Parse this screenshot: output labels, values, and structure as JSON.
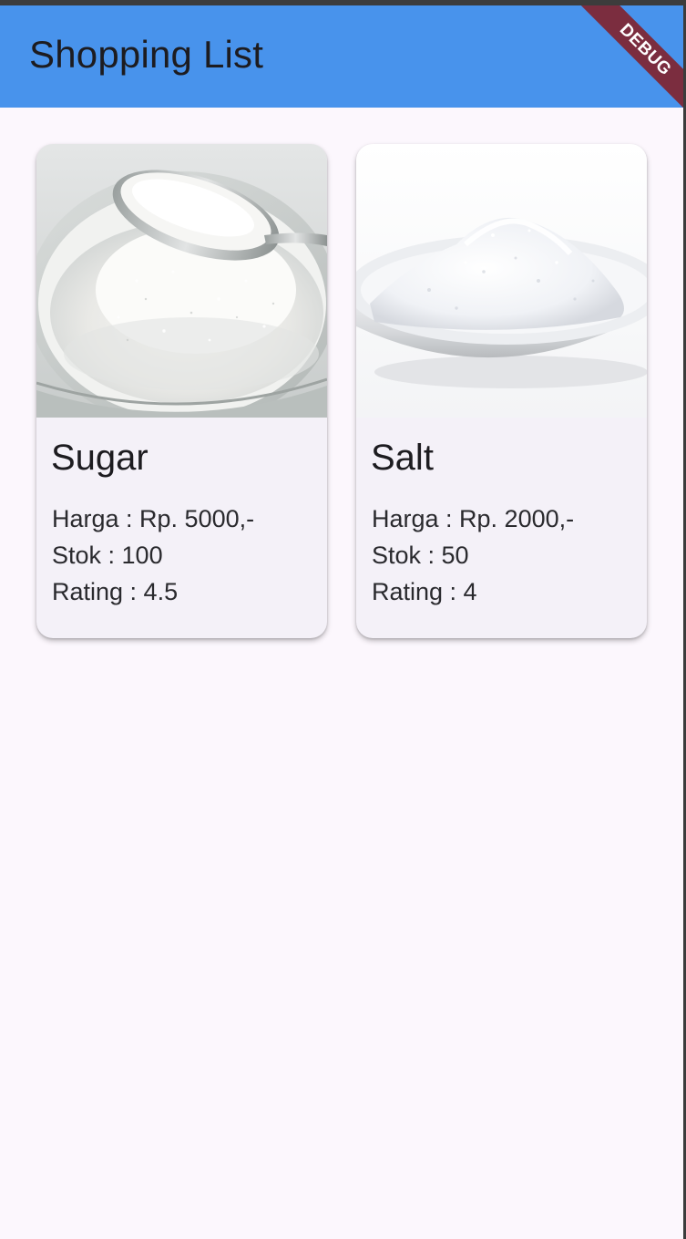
{
  "app": {
    "title": "Shopping List",
    "debug_label": "DEBUG",
    "colors": {
      "appbar": "#4893ec",
      "background": "#fcf7fd",
      "card": "#f4f1f8",
      "debug_banner": "#7b2d3f"
    }
  },
  "items": [
    {
      "name": "Sugar",
      "price": "Harga : Rp. 5000,-",
      "stock": "Stok : 100",
      "rating": "Rating : 4.5",
      "image_icon": "sugar-bowl-photo"
    },
    {
      "name": "Salt",
      "price": "Harga : Rp. 2000,-",
      "stock": "Stok : 50",
      "rating": "Rating : 4",
      "image_icon": "salt-bowl-photo"
    }
  ]
}
